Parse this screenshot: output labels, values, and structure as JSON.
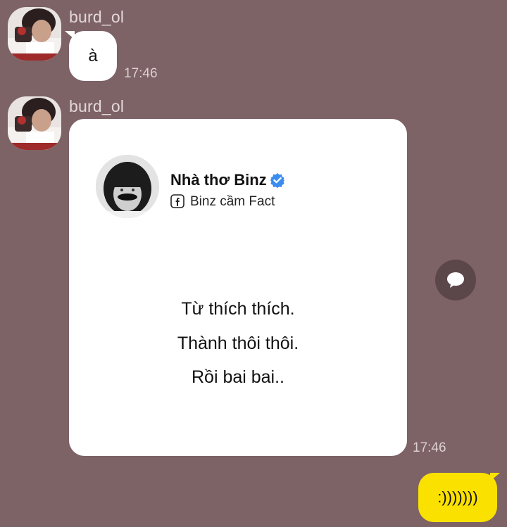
{
  "colors": {
    "background": "#7d6266",
    "incoming_bubble": "#ffffff",
    "outgoing_bubble": "#fae100",
    "verified_badge": "#3b8cf0"
  },
  "messages": {
    "first": {
      "sender": "burd_ol",
      "text": "à",
      "time": "17:46",
      "avatar_icon": "user-avatar-photo"
    },
    "second": {
      "sender": "burd_ol",
      "time": "17:46",
      "avatar_icon": "user-avatar-photo",
      "image_card": {
        "page_name": "Nhà thơ Binz",
        "page_subtitle": "Binz cầm Fact",
        "verified_icon": "verified-check-icon",
        "platform_icon": "facebook-icon",
        "quote_lines": [
          "Từ thích thích.",
          "Thành thôi thôi.",
          "Rồi bai bai.."
        ]
      },
      "share_icon": "chat-bubble-icon"
    },
    "mine": {
      "text": ":)))))))"
    }
  }
}
